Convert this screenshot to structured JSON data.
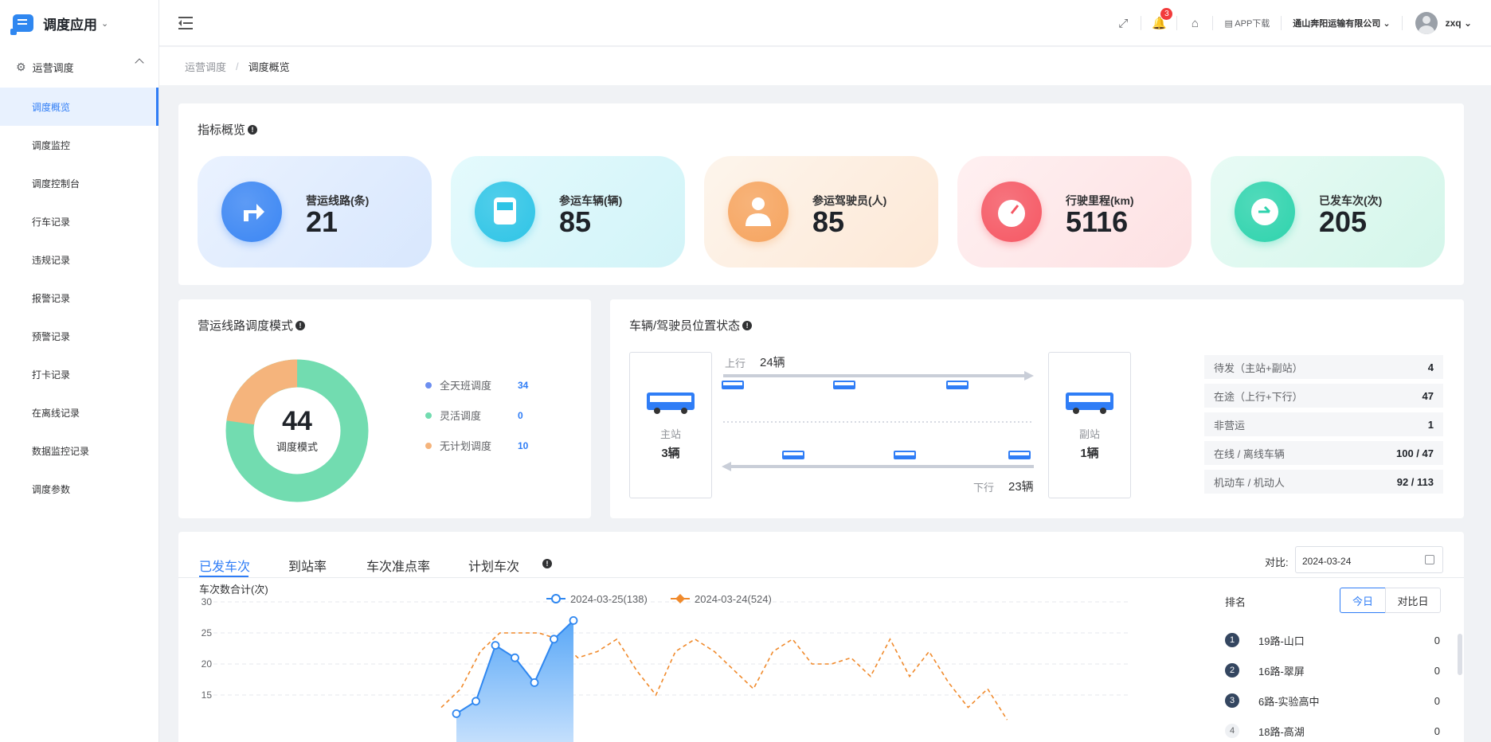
{
  "sidebar": {
    "app_title": "调度应用",
    "group_label": "运营调度",
    "items": [
      "调度概览",
      "调度监控",
      "调度控制台",
      "行车记录",
      "违规记录",
      "报警记录",
      "预警记录",
      "打卡记录",
      "在离线记录",
      "数据监控记录",
      "调度参数"
    ]
  },
  "header": {
    "badge_count": "3",
    "app_download": "APP下载",
    "company": "通山奔阳运输有限公司",
    "user": "zxq"
  },
  "breadcrumb": {
    "parent": "运营调度",
    "current": "调度概览"
  },
  "indicators": {
    "title": "指标概览",
    "cards": [
      {
        "label": "营运线路(条)",
        "value": "21",
        "color": "#3b86f3"
      },
      {
        "label": "参运车辆(辆)",
        "value": "85",
        "color": "#2ec4e6"
      },
      {
        "label": "参运驾驶员(人)",
        "value": "85",
        "color": "#f6a45f"
      },
      {
        "label": "行驶里程(km)",
        "value": "5116",
        "color": "#f55763"
      },
      {
        "label": "已发车次(次)",
        "value": "205",
        "color": "#2ed3ad"
      }
    ]
  },
  "mode": {
    "title": "营运线路调度模式",
    "center_value": "44",
    "center_label": "调度模式",
    "legend": [
      {
        "name": "全天班调度",
        "value": "34",
        "color": "#6d8ff0"
      },
      {
        "name": "灵活调度",
        "value": "0",
        "color": "#72dcb0"
      },
      {
        "name": "无计划调度",
        "value": "10",
        "color": "#f5b47c"
      }
    ]
  },
  "position": {
    "title": "车辆/驾驶员位置状态",
    "main_station": "主站",
    "main_count": "3辆",
    "sub_station": "副站",
    "sub_count": "1辆",
    "up_label": "上行",
    "up_count": "24辆",
    "down_label": "下行",
    "down_count": "23辆",
    "stats": [
      {
        "label": "待发（主站+副站）",
        "value": "4"
      },
      {
        "label": "在途（上行+下行）",
        "value": "47"
      },
      {
        "label": "非营运",
        "value": "1"
      },
      {
        "label": "在线 / 离线车辆",
        "value": "100 / 47"
      },
      {
        "label": "机动车 / 机动人",
        "value": "92 / 113"
      }
    ]
  },
  "bottom": {
    "tabs": [
      "已发车次",
      "到站率",
      "车次准点率",
      "计划车次"
    ],
    "compare_label": "对比:",
    "compare_date": "2024-03-24",
    "rank_title": "排名",
    "btn_today": "今日",
    "btn_compare": "对比日",
    "ranking": [
      {
        "rank": "1",
        "name": "19路-山口",
        "count": "0"
      },
      {
        "rank": "2",
        "name": "16路-翠屏",
        "count": "0"
      },
      {
        "rank": "3",
        "name": "6路-实验高中",
        "count": "0"
      },
      {
        "rank": "4",
        "name": "18路-高湖",
        "count": "0"
      }
    ]
  },
  "chart_data": {
    "type": "line",
    "ylabel": "车次数合计(次)",
    "yticks": [
      15,
      20,
      25,
      30
    ],
    "ylim": [
      15,
      30
    ],
    "series": [
      {
        "name": "2024-03-25(138)",
        "color": "#2f87f0",
        "style": "solid-area",
        "values": [
          12,
          14,
          23,
          21,
          17,
          24,
          27
        ]
      },
      {
        "name": "2024-03-24(524)",
        "color": "#f08a2c",
        "style": "dashed",
        "values": [
          13,
          16,
          22,
          25,
          25,
          25,
          24,
          21,
          22,
          24,
          19,
          15,
          22,
          24,
          22,
          19,
          16,
          22,
          24,
          20,
          20,
          21,
          18,
          24,
          18,
          22,
          17,
          13,
          16,
          11
        ]
      }
    ]
  }
}
